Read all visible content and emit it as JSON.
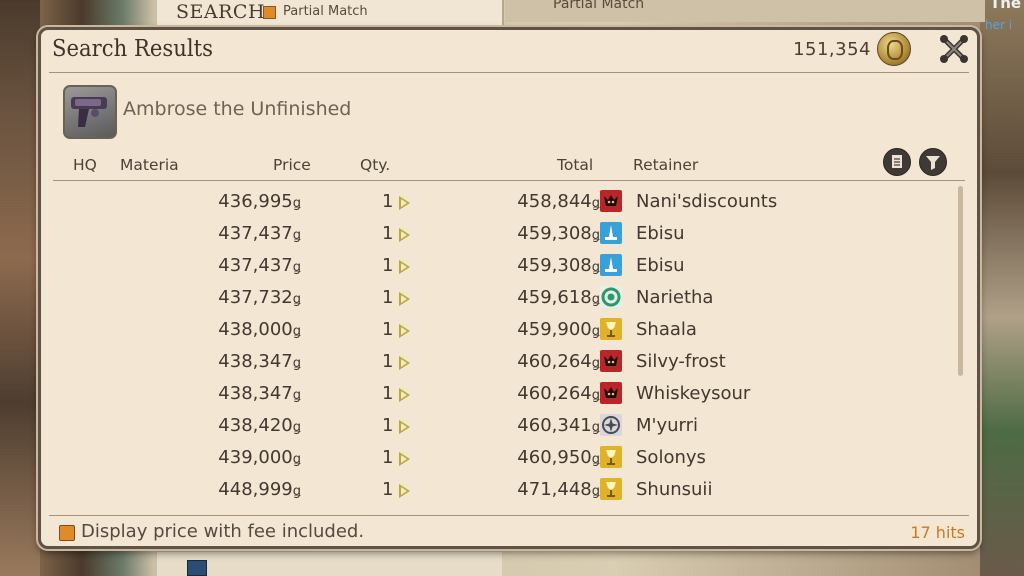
{
  "background": {
    "search_label": "SEARCH",
    "partial_match_label": "Partial Match",
    "partial_match_label_2": "Partial Match",
    "corner_text": "The",
    "corner_text_2": "her i"
  },
  "window": {
    "title": "Search Results",
    "gil_amount": "151,354",
    "item_name": "Ambrose the Unfinished"
  },
  "columns": {
    "hq": "HQ",
    "materia": "Materia",
    "price": "Price",
    "qty": "Qty.",
    "total": "Total",
    "retainer": "Retainer"
  },
  "currency_symbol": "ǥ",
  "colors": {
    "accent_orange": "#e08a2a",
    "hits_color": "#c97a1f",
    "qty_arrow": "#b7ad2a"
  },
  "listings": [
    {
      "price": "436,995",
      "qty": "1",
      "total": "458,844",
      "retainer": "Nani'sdiscounts",
      "city": "red"
    },
    {
      "price": "437,437",
      "qty": "1",
      "total": "459,308",
      "retainer": "Ebisu",
      "city": "blue"
    },
    {
      "price": "437,437",
      "qty": "1",
      "total": "459,308",
      "retainer": "Ebisu",
      "city": "blue"
    },
    {
      "price": "437,732",
      "qty": "1",
      "total": "459,618",
      "retainer": "Narietha",
      "city": "green"
    },
    {
      "price": "438,000",
      "qty": "1",
      "total": "459,900",
      "retainer": "Shaala",
      "city": "gold"
    },
    {
      "price": "438,347",
      "qty": "1",
      "total": "460,264",
      "retainer": "Silvy-frost",
      "city": "red"
    },
    {
      "price": "438,347",
      "qty": "1",
      "total": "460,264",
      "retainer": "Whiskeysour",
      "city": "red"
    },
    {
      "price": "438,420",
      "qty": "1",
      "total": "460,341",
      "retainer": "M'yurri",
      "city": "silver"
    },
    {
      "price": "439,000",
      "qty": "1",
      "total": "460,950",
      "retainer": "Solonys",
      "city": "gold"
    },
    {
      "price": "448,999",
      "qty": "1",
      "total": "471,448",
      "retainer": "Shunsuii",
      "city": "gold"
    }
  ],
  "footer": {
    "fee_label": "Display price with fee included.",
    "hits": "17 hits"
  }
}
